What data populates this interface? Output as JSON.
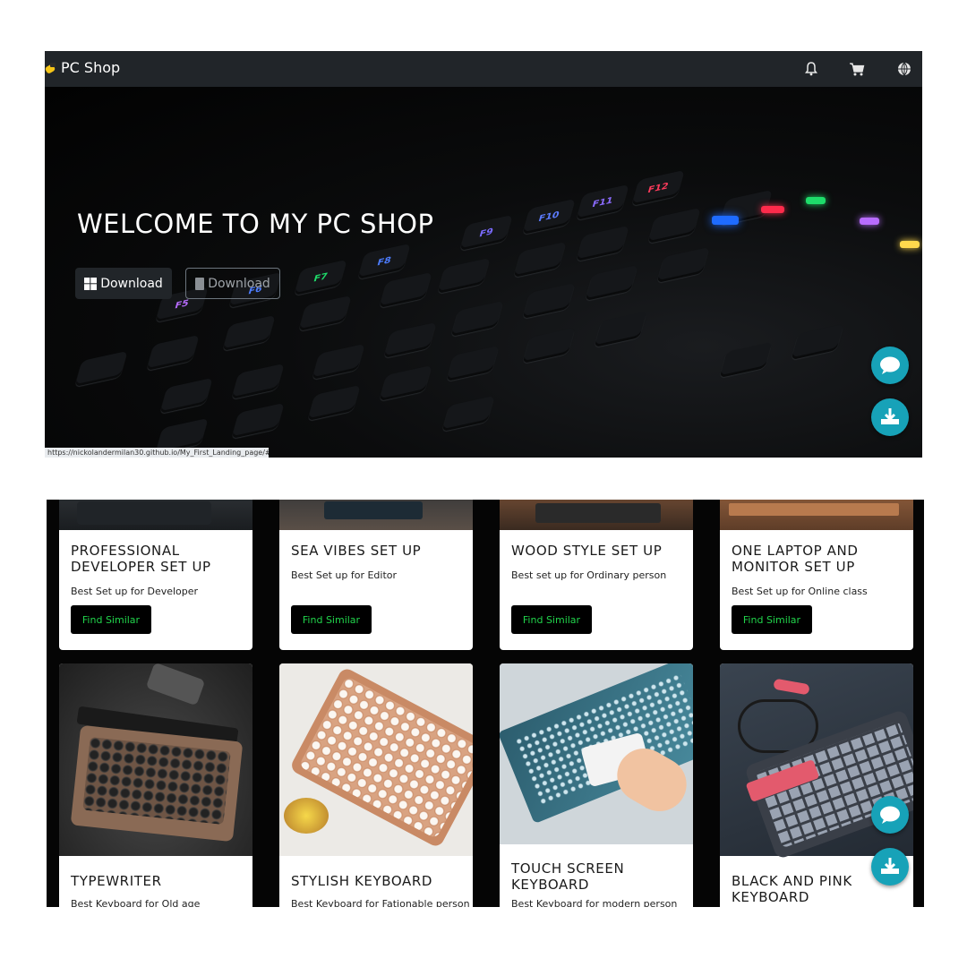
{
  "navbar": {
    "brand": "PC Shop",
    "icons": [
      "bell-icon",
      "cart-icon",
      "globe-icon"
    ]
  },
  "hero": {
    "title": "WELCOME TO MY PC SHOP",
    "windows_button": "Download",
    "mac_button": "Download",
    "keys": [
      "F5",
      "F6",
      "F7",
      "F8",
      "F9",
      "F10",
      "F11",
      "F12"
    ],
    "status_url": "https://nickolandermilan30.github.io/My_First_Landing_page/#"
  },
  "cards_top": [
    {
      "title": "PROFESSIONAL DEVELOPER SET UP",
      "text": "Best Set up for Developer",
      "button": "Find Similar"
    },
    {
      "title": "SEA VIBES SET UP",
      "text": "Best Set up for Editor",
      "button": "Find Similar"
    },
    {
      "title": "WOOD STYLE SET UP",
      "text": "Best set up for Ordinary person",
      "button": "Find Similar"
    },
    {
      "title": "ONE LAPTOP AND MONITOR SET UP",
      "text": "Best Set up for Online class",
      "button": "Find Similar"
    }
  ],
  "cards_bottom": [
    {
      "title": "TYPEWRITER",
      "text": "Best Keyboard for Old age"
    },
    {
      "title": "STYLISH KEYBOARD",
      "text": "Best Keyboard for Fationable person"
    },
    {
      "title": "TOUCH SCREEN KEYBOARD",
      "text": "Best Keyboard for modern person"
    },
    {
      "title": "BLACK AND PINK KEYBOARD",
      "text": ""
    }
  ],
  "colors": {
    "navbar_bg": "#212529",
    "accent_teal": "#17a2b8",
    "find_button_text": "#21d44b"
  }
}
